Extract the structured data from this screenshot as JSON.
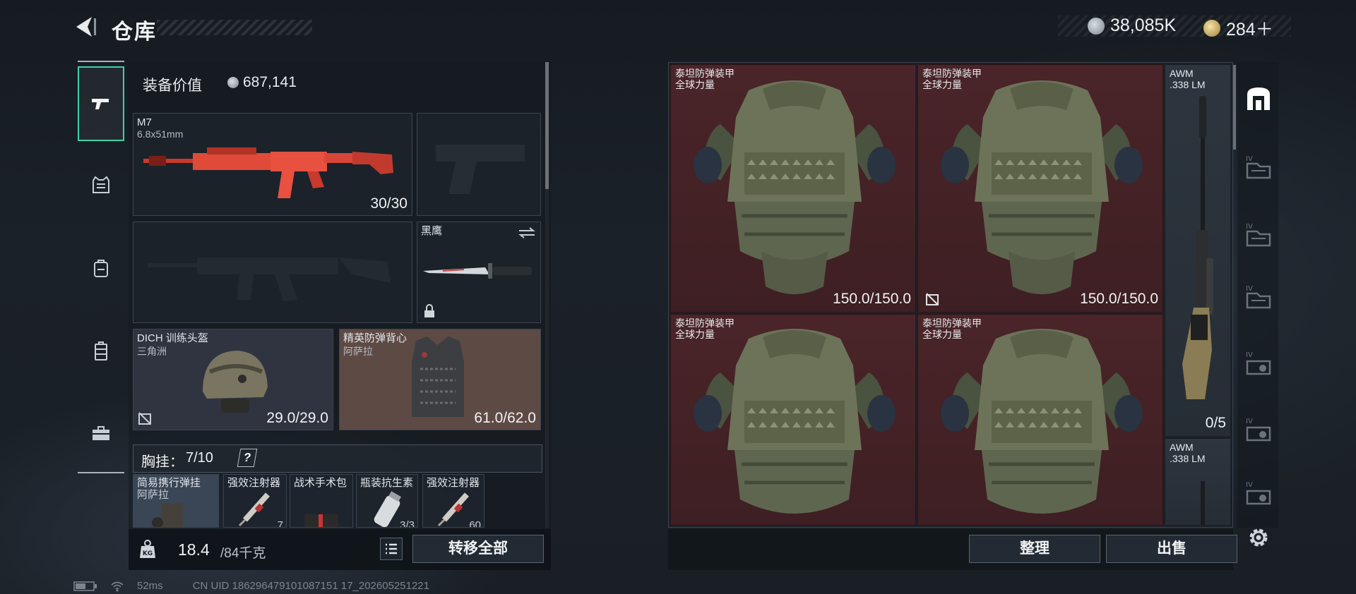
{
  "header": {
    "title": "仓库",
    "silver": "38,085K",
    "gold": "284＋"
  },
  "sidebar": {
    "tabs": [
      "weapon",
      "armor",
      "backpack",
      "chest-rig",
      "toolbox"
    ]
  },
  "loadout": {
    "value_label": "装备价值",
    "value": "687,141",
    "primary": {
      "name": "M7",
      "caliber": "6.8x51mm",
      "ammo": "30/30"
    },
    "melee": {
      "name": "黑鹰"
    },
    "helmet": {
      "name": "DICH 训练头盔",
      "map": "三角洲",
      "durability": "29.0/29.0"
    },
    "vest": {
      "name": "精英防弹背心",
      "map": "阿萨拉",
      "durability": "61.0/62.0"
    },
    "chest": {
      "label": "胸挂：",
      "count": "7/10",
      "help": "?"
    },
    "chest_items": [
      {
        "name": "简易携行弹挂",
        "sub": "阿萨拉"
      },
      {
        "name": "强效注射器",
        "qty": "7"
      },
      {
        "name": "战术手术包"
      },
      {
        "name": "瓶装抗生素",
        "qty": "3/3"
      },
      {
        "name": "强效注射器",
        "qty": "60"
      }
    ],
    "weight": "18.4",
    "weight_max": "/84千克",
    "transfer_all": "转移全部"
  },
  "stash": {
    "items": [
      {
        "name": "泰坦防弹装甲",
        "sub": "全球力量",
        "value": "150.0/150.0"
      },
      {
        "name": "泰坦防弹装甲",
        "sub": "全球力量",
        "value": "150.0/150.0"
      },
      {
        "name": "泰坦防弹装甲",
        "sub": "全球力量"
      },
      {
        "name": "泰坦防弹装甲",
        "sub": "全球力量"
      }
    ],
    "rifles": [
      {
        "name": "AWM",
        "sub": ".338 LM",
        "value": "0/5"
      },
      {
        "name": "AWM",
        "sub": ".338 LM"
      }
    ],
    "sort_label": "整理",
    "sell_label": "出售"
  },
  "right_rail": {
    "tier": "IV"
  },
  "footer": {
    "ping": "52ms",
    "uid": "CN UID 186296479101087151 17_202605251221"
  },
  "colors": {
    "accent": "#3fd1a8",
    "red_cell": "#4a2428",
    "vest_cell": "#6b5048"
  }
}
